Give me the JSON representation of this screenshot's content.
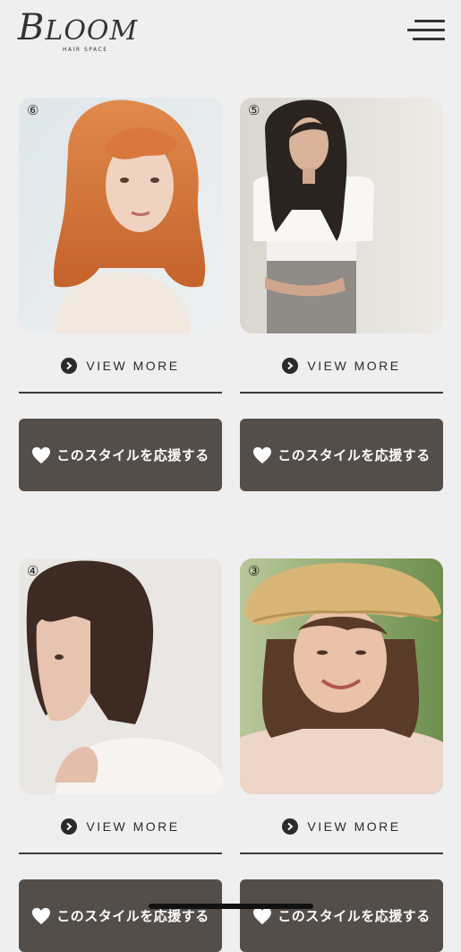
{
  "header": {
    "logo_main": "LOOM",
    "logo_initial": "B",
    "logo_sub": "HAIR SPACE",
    "menu_icon": "hamburger-icon"
  },
  "cards": [
    {
      "number": "⑥",
      "view_more": "VIEW MORE",
      "support": "このスタイルを応援する"
    },
    {
      "number": "⑤",
      "view_more": "VIEW MORE",
      "support": "このスタイルを応援する"
    },
    {
      "number": "④",
      "view_more": "VIEW MORE",
      "support": "このスタイルを応援する"
    },
    {
      "number": "③",
      "view_more": "VIEW MORE",
      "support": "このスタイルを応援する"
    }
  ],
  "partial": [
    {
      "support": "このスタイルを応援する"
    },
    {
      "support": "このスタイルを応援する"
    }
  ],
  "colors": {
    "background": "#efefef",
    "button": "#544e4b",
    "text": "#2b2b2b"
  }
}
